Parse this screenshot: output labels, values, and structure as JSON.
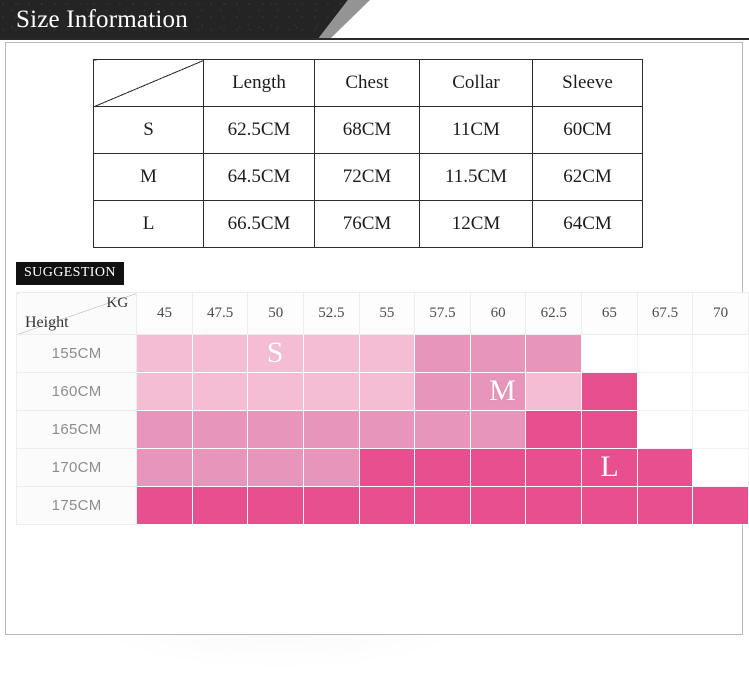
{
  "header": {
    "title": "Size Information"
  },
  "size_table": {
    "columns": [
      "",
      "Length",
      "Chest",
      "Collar",
      "Sleeve"
    ],
    "rows": [
      {
        "size": "S",
        "length": "62.5CM",
        "chest": "68CM",
        "collar": "11CM",
        "sleeve": "60CM"
      },
      {
        "size": "M",
        "length": "64.5CM",
        "chest": "72CM",
        "collar": "11.5CM",
        "sleeve": "62CM"
      },
      {
        "size": "L",
        "length": "66.5CM",
        "chest": "76CM",
        "collar": "12CM",
        "sleeve": "64CM"
      }
    ]
  },
  "suggestion": {
    "tag_label": "SUGGESTION",
    "weight_axis_label": "KG",
    "height_axis_label": "Height",
    "weights": [
      "45",
      "47.5",
      "50",
      "52.5",
      "55",
      "57.5",
      "60",
      "62.5",
      "65",
      "67.5",
      "70"
    ],
    "heights": [
      "155CM",
      "160CM",
      "165CM",
      "170CM",
      "175CM"
    ],
    "markers": [
      {
        "label": "S",
        "row": 0,
        "col": 2
      },
      {
        "label": "M",
        "row": 1,
        "col": 6
      },
      {
        "label": "L",
        "row": 3,
        "col": 8
      }
    ],
    "legend": {
      "none": "#ffffff",
      "light": "#f4bdd4",
      "mid": "#e795bb",
      "deep": "#e74f8e"
    },
    "matrix": [
      [
        "light",
        "light",
        "light",
        "light",
        "light",
        "mid",
        "mid",
        "mid",
        "none",
        "none",
        "none"
      ],
      [
        "light",
        "light",
        "light",
        "light",
        "light",
        "mid",
        "mid",
        "light",
        "deep",
        "none",
        "none"
      ],
      [
        "mid",
        "mid",
        "mid",
        "mid",
        "mid",
        "mid",
        "mid",
        "deep",
        "deep",
        "none",
        "none"
      ],
      [
        "mid",
        "mid",
        "mid",
        "mid",
        "deep",
        "deep",
        "deep",
        "deep",
        "deep",
        "deep",
        "none"
      ],
      [
        "deep",
        "deep",
        "deep",
        "deep",
        "deep",
        "deep",
        "deep",
        "deep",
        "deep",
        "deep",
        "deep"
      ]
    ]
  }
}
